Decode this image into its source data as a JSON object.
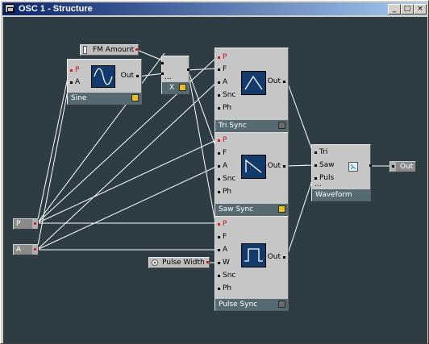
{
  "window": {
    "title": "OSC 1 - Structure",
    "buttons": {
      "minimize": "_",
      "maximize": "□",
      "close": "×"
    }
  },
  "colors": {
    "canvas": "#2e3c44",
    "module_body": "#c6c6c6",
    "module_footer": "#566a72",
    "display_bg": "#123a6a",
    "wire": "#ffffff",
    "led_yellow": "#e8c020",
    "led_gray": "#6a6a6a",
    "port_active": "#c01818"
  },
  "terminals": {
    "p": "P",
    "a": "A"
  },
  "controls": {
    "fm_amount": "FM Amount",
    "pulse_width": "Pulse Width"
  },
  "modules": {
    "sine": {
      "name": "Sine",
      "in_p": "P",
      "in_a": "A",
      "out": "Out",
      "display_icon": "sine-wave-icon"
    },
    "mult": {
      "name": "X",
      "in_1": "",
      "in_2": "",
      "out": "",
      "more": "..."
    },
    "tri": {
      "name": "Tri Sync",
      "in_p": "P",
      "in_f": "F",
      "in_a": "A",
      "in_snc": "Snc",
      "in_ph": "Ph",
      "out": "Out",
      "display_icon": "triangle-wave-icon"
    },
    "saw": {
      "name": "Saw Sync",
      "in_p": "P",
      "in_f": "F",
      "in_a": "A",
      "in_snc": "Snc",
      "in_ph": "Ph",
      "out": "Out",
      "display_icon": "saw-wave-icon"
    },
    "pulse": {
      "name": "Pulse Sync",
      "in_p": "P",
      "in_f": "F",
      "in_a": "A",
      "in_w": "W",
      "in_snc": "Snc",
      "in_ph": "Ph",
      "out": "Out",
      "display_icon": "pulse-wave-icon"
    },
    "waveform": {
      "name": "Waveform",
      "in_tri": "Tri",
      "in_saw": "Saw",
      "in_puls": "Puls",
      "more": "...",
      "display_icon": "selector-icon"
    }
  },
  "output_terminal": "Out"
}
